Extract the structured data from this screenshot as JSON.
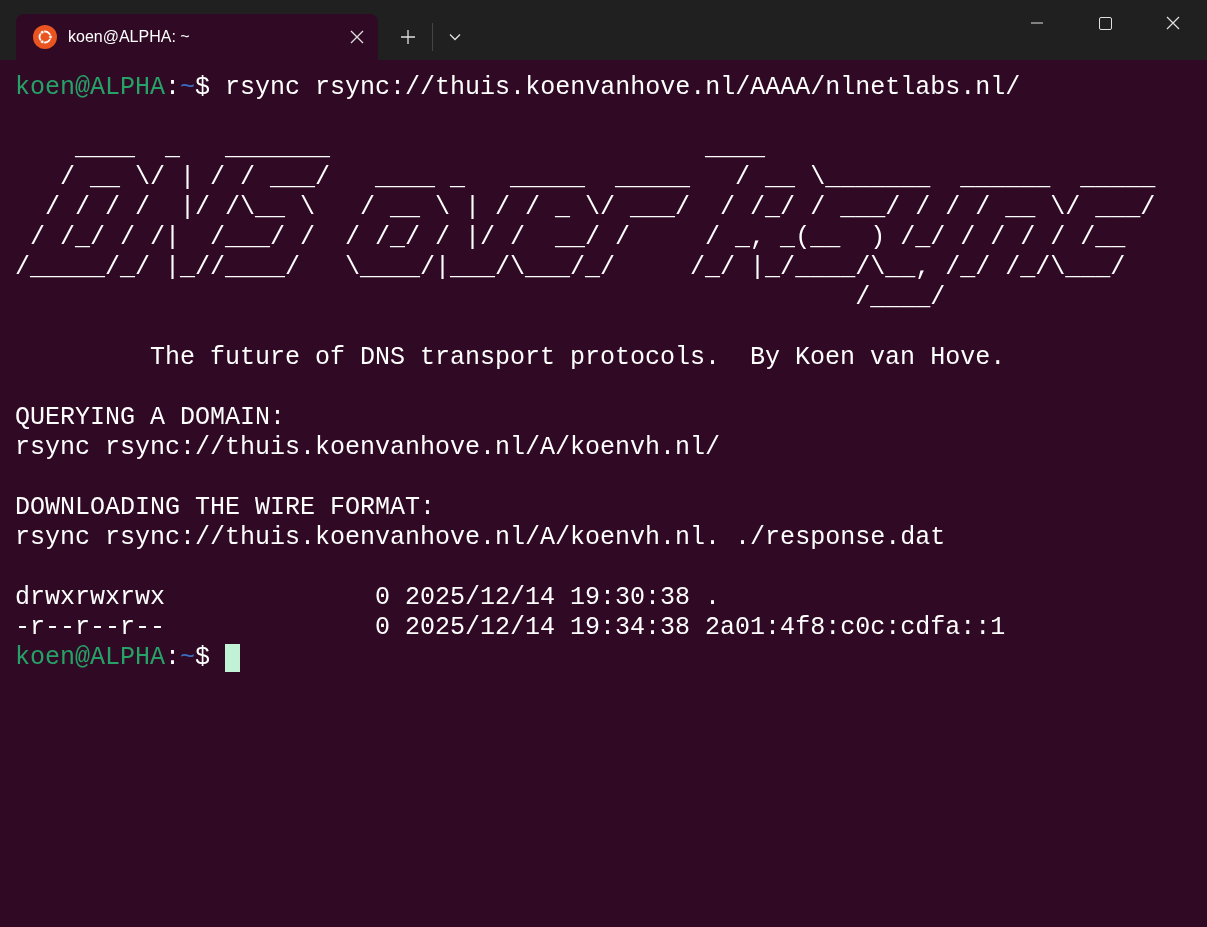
{
  "tab": {
    "title": "koen@ALPHA: ~",
    "selected": true
  },
  "terminal": {
    "lines": [
      {
        "kind": "prompt",
        "user_host": "koen@ALPHA",
        "sep": ":",
        "path": "~",
        "symbol": "$",
        "command": "rsync rsync://thuis.koenvanhove.nl/AAAA/nlnetlabs.nl/",
        "cursor": false
      },
      {
        "kind": "blank"
      },
      {
        "kind": "art",
        "rows": [
          "    ____  _   _______                         ____",
          "   / __ \\/ | / / ___/   ____ _   _____  _____   / __ \\_______  ______  _____",
          "  / / / /  |/ /\\__ \\   / __ \\ | / / _ \\/ ___/  / /_/ / ___/ / / / __ \\/ ___/",
          " / /_/ / /|  /___/ /  / /_/ / |/ /  __/ /     / _, _(__  ) /_/ / / / / /__",
          "/_____/_/ |_//____/   \\____/|___/\\___/_/     /_/ |_/____/\\__, /_/ /_/\\___/",
          "                                                        /____/"
        ]
      },
      {
        "kind": "blank"
      },
      {
        "kind": "tagline",
        "text": "The future of DNS transport protocols.  By Koen van Hove."
      },
      {
        "kind": "blank"
      },
      {
        "kind": "text",
        "text": "QUERYING A DOMAIN:"
      },
      {
        "kind": "text",
        "text": "rsync rsync://thuis.koenvanhove.nl/A/koenvh.nl/"
      },
      {
        "kind": "blank"
      },
      {
        "kind": "text",
        "text": "DOWNLOADING THE WIRE FORMAT:"
      },
      {
        "kind": "text",
        "text": "rsync rsync://thuis.koenvanhove.nl/A/koenvh.nl. ./response.dat"
      },
      {
        "kind": "blank"
      },
      {
        "kind": "text",
        "text": "drwxrwxrwx              0 2025/12/14 19:30:38 ."
      },
      {
        "kind": "text",
        "text": "-r--r--r--              0 2025/12/14 19:34:38 2a01:4f8:c0c:cdfa::1"
      },
      {
        "kind": "prompt",
        "user_host": "koen@ALPHA",
        "sep": ":",
        "path": "~",
        "symbol": "$",
        "cursor": true
      }
    ]
  }
}
